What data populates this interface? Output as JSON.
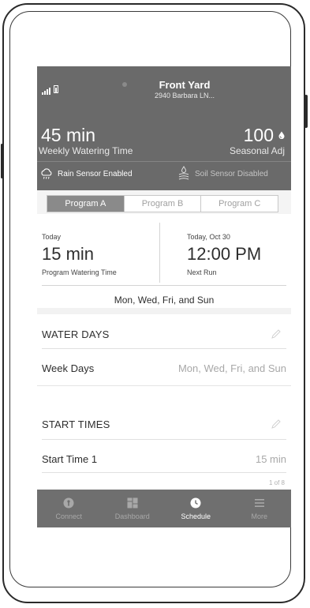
{
  "header": {
    "site_name": "Front Yard",
    "address": "2940 Barbara LN...",
    "weekly_value": "45 min",
    "weekly_label": "Weekly Watering Time",
    "seasonal_value": "100",
    "seasonal_label": "Seasonal Adj",
    "rain_sensor": "Rain Sensor Enabled",
    "soil_sensor": "Soil Sensor Disabled"
  },
  "programs": {
    "tabs": [
      "Program A",
      "Program B",
      "Program C"
    ],
    "active_index": 0
  },
  "summary": {
    "left_label": "Today",
    "left_value": "15 min",
    "left_sub": "Program Watering Time",
    "right_label": "Today, Oct 30",
    "right_value": "12:00 PM",
    "right_sub": "Next Run",
    "days": "Mon, Wed, Fri, and Sun"
  },
  "water_days": {
    "title": "WATER DAYS",
    "row_label": "Week Days",
    "row_value": "Mon, Wed, Fri, and Sun"
  },
  "start_times": {
    "title": "START TIMES",
    "row_label": "Start Time 1",
    "row_value": "15 min",
    "pager": "1 of 8"
  },
  "nav": {
    "items": [
      {
        "label": "Connect",
        "icon": "connect-icon"
      },
      {
        "label": "Dashboard",
        "icon": "dashboard-icon"
      },
      {
        "label": "Schedule",
        "icon": "clock-icon"
      },
      {
        "label": "More",
        "icon": "menu-icon"
      }
    ],
    "active_index": 2
  },
  "colors": {
    "header_bg": "#6a6a6a",
    "nav_bg": "#6f6f6f",
    "tab_active_bg": "#8a8a8a"
  }
}
